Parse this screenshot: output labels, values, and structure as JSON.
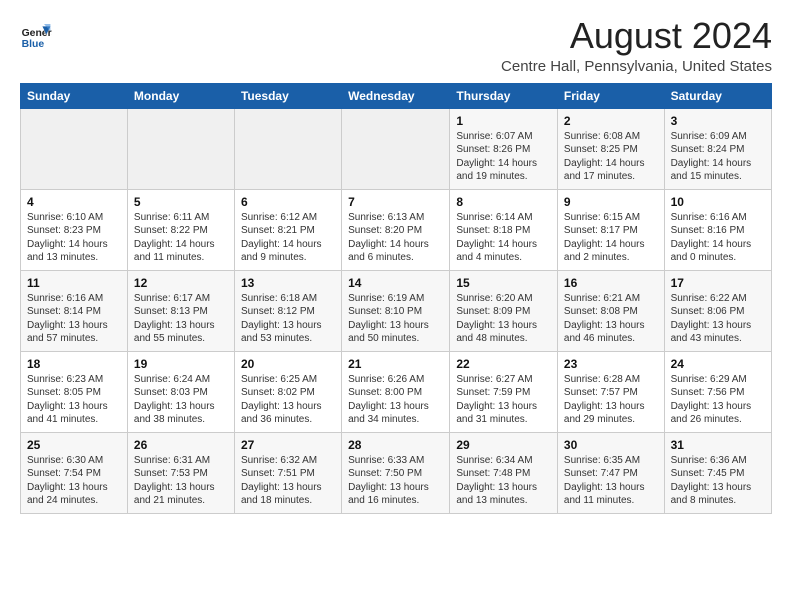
{
  "header": {
    "logo_line1": "General",
    "logo_line2": "Blue",
    "title": "August 2024",
    "subtitle": "Centre Hall, Pennsylvania, United States"
  },
  "weekdays": [
    "Sunday",
    "Monday",
    "Tuesday",
    "Wednesday",
    "Thursday",
    "Friday",
    "Saturday"
  ],
  "weeks": [
    [
      {
        "day": "",
        "info": ""
      },
      {
        "day": "",
        "info": ""
      },
      {
        "day": "",
        "info": ""
      },
      {
        "day": "",
        "info": ""
      },
      {
        "day": "1",
        "info": "Sunrise: 6:07 AM\nSunset: 8:26 PM\nDaylight: 14 hours and 19 minutes."
      },
      {
        "day": "2",
        "info": "Sunrise: 6:08 AM\nSunset: 8:25 PM\nDaylight: 14 hours and 17 minutes."
      },
      {
        "day": "3",
        "info": "Sunrise: 6:09 AM\nSunset: 8:24 PM\nDaylight: 14 hours and 15 minutes."
      }
    ],
    [
      {
        "day": "4",
        "info": "Sunrise: 6:10 AM\nSunset: 8:23 PM\nDaylight: 14 hours and 13 minutes."
      },
      {
        "day": "5",
        "info": "Sunrise: 6:11 AM\nSunset: 8:22 PM\nDaylight: 14 hours and 11 minutes."
      },
      {
        "day": "6",
        "info": "Sunrise: 6:12 AM\nSunset: 8:21 PM\nDaylight: 14 hours and 9 minutes."
      },
      {
        "day": "7",
        "info": "Sunrise: 6:13 AM\nSunset: 8:20 PM\nDaylight: 14 hours and 6 minutes."
      },
      {
        "day": "8",
        "info": "Sunrise: 6:14 AM\nSunset: 8:18 PM\nDaylight: 14 hours and 4 minutes."
      },
      {
        "day": "9",
        "info": "Sunrise: 6:15 AM\nSunset: 8:17 PM\nDaylight: 14 hours and 2 minutes."
      },
      {
        "day": "10",
        "info": "Sunrise: 6:16 AM\nSunset: 8:16 PM\nDaylight: 14 hours and 0 minutes."
      }
    ],
    [
      {
        "day": "11",
        "info": "Sunrise: 6:16 AM\nSunset: 8:14 PM\nDaylight: 13 hours and 57 minutes."
      },
      {
        "day": "12",
        "info": "Sunrise: 6:17 AM\nSunset: 8:13 PM\nDaylight: 13 hours and 55 minutes."
      },
      {
        "day": "13",
        "info": "Sunrise: 6:18 AM\nSunset: 8:12 PM\nDaylight: 13 hours and 53 minutes."
      },
      {
        "day": "14",
        "info": "Sunrise: 6:19 AM\nSunset: 8:10 PM\nDaylight: 13 hours and 50 minutes."
      },
      {
        "day": "15",
        "info": "Sunrise: 6:20 AM\nSunset: 8:09 PM\nDaylight: 13 hours and 48 minutes."
      },
      {
        "day": "16",
        "info": "Sunrise: 6:21 AM\nSunset: 8:08 PM\nDaylight: 13 hours and 46 minutes."
      },
      {
        "day": "17",
        "info": "Sunrise: 6:22 AM\nSunset: 8:06 PM\nDaylight: 13 hours and 43 minutes."
      }
    ],
    [
      {
        "day": "18",
        "info": "Sunrise: 6:23 AM\nSunset: 8:05 PM\nDaylight: 13 hours and 41 minutes."
      },
      {
        "day": "19",
        "info": "Sunrise: 6:24 AM\nSunset: 8:03 PM\nDaylight: 13 hours and 38 minutes."
      },
      {
        "day": "20",
        "info": "Sunrise: 6:25 AM\nSunset: 8:02 PM\nDaylight: 13 hours and 36 minutes."
      },
      {
        "day": "21",
        "info": "Sunrise: 6:26 AM\nSunset: 8:00 PM\nDaylight: 13 hours and 34 minutes."
      },
      {
        "day": "22",
        "info": "Sunrise: 6:27 AM\nSunset: 7:59 PM\nDaylight: 13 hours and 31 minutes."
      },
      {
        "day": "23",
        "info": "Sunrise: 6:28 AM\nSunset: 7:57 PM\nDaylight: 13 hours and 29 minutes."
      },
      {
        "day": "24",
        "info": "Sunrise: 6:29 AM\nSunset: 7:56 PM\nDaylight: 13 hours and 26 minutes."
      }
    ],
    [
      {
        "day": "25",
        "info": "Sunrise: 6:30 AM\nSunset: 7:54 PM\nDaylight: 13 hours and 24 minutes."
      },
      {
        "day": "26",
        "info": "Sunrise: 6:31 AM\nSunset: 7:53 PM\nDaylight: 13 hours and 21 minutes."
      },
      {
        "day": "27",
        "info": "Sunrise: 6:32 AM\nSunset: 7:51 PM\nDaylight: 13 hours and 18 minutes."
      },
      {
        "day": "28",
        "info": "Sunrise: 6:33 AM\nSunset: 7:50 PM\nDaylight: 13 hours and 16 minutes."
      },
      {
        "day": "29",
        "info": "Sunrise: 6:34 AM\nSunset: 7:48 PM\nDaylight: 13 hours and 13 minutes."
      },
      {
        "day": "30",
        "info": "Sunrise: 6:35 AM\nSunset: 7:47 PM\nDaylight: 13 hours and 11 minutes."
      },
      {
        "day": "31",
        "info": "Sunrise: 6:36 AM\nSunset: 7:45 PM\nDaylight: 13 hours and 8 minutes."
      }
    ]
  ]
}
